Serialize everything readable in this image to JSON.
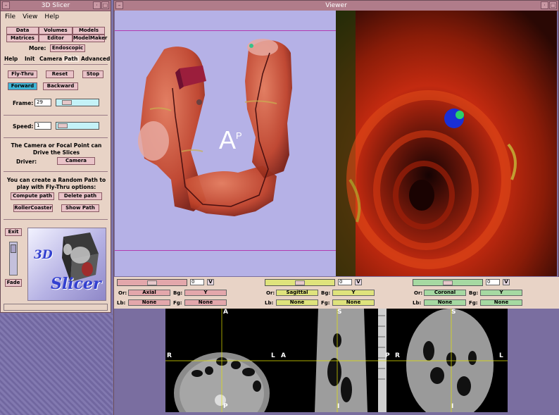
{
  "control_window": {
    "title": "3D Slicer",
    "menu": [
      "File",
      "View",
      "Help"
    ],
    "modules_row1": [
      "Data",
      "Volumes",
      "Models"
    ],
    "modules_row2": [
      "Matrices",
      "Editor",
      "ModelMaker"
    ],
    "more_label": "More:",
    "more_value": "Endoscopic",
    "tabs": [
      "Help",
      "Init",
      "Camera",
      "Path",
      "Advanced"
    ],
    "path": {
      "fly_thru": "Fly-Thru",
      "reset": "Reset",
      "stop": "Stop",
      "forward": "Forward",
      "backward": "Backward",
      "frame_label": "Frame:",
      "frame_value": "29",
      "speed_label": "Speed:",
      "speed_value": "1",
      "camera_note": "The Camera or Focal Point can Drive the Slices",
      "driver_label": "Driver:",
      "driver_value": "Camera",
      "random_note": "You can create a Random Path to play with Fly-Thru options:",
      "compute_path": "Compute path",
      "delete_path": "Delete path",
      "rollercoaster": "RollerCoaster",
      "show_path": "Show Path"
    },
    "exit": "Exit",
    "fade": "Fade",
    "logo_text_1": "3D",
    "logo_text_2": "Slicer"
  },
  "viewer_window": {
    "title": "Viewer",
    "orientation_letters": [
      "A",
      "P"
    ]
  },
  "slice_controls": [
    {
      "value": "0",
      "v": "V",
      "or_label": "Or:",
      "or_value": "Axial",
      "bg_label": "Bg:",
      "bg_value": "Y",
      "lb_label": "Lb:",
      "lb_value": "None",
      "fg_label": "Fg:",
      "fg_value": "None",
      "color": "#e3a7ab"
    },
    {
      "value": "0",
      "v": "V",
      "or_label": "Or:",
      "or_value": "Sagittal",
      "bg_label": "Bg:",
      "bg_value": "Y",
      "lb_label": "Lb:",
      "lb_value": "None",
      "fg_label": "Fg:",
      "fg_value": "None",
      "color": "#dfe37c"
    },
    {
      "value": "0",
      "v": "V",
      "or_label": "Or:",
      "or_value": "Coronal",
      "bg_label": "Bg:",
      "bg_value": "Y",
      "lb_label": "Lb:",
      "lb_value": "None",
      "fg_label": "Fg:",
      "fg_value": "None",
      "color": "#a6d9a2"
    }
  ],
  "slice_labels": {
    "axial": {
      "top": "A",
      "left": "R",
      "right": "L",
      "bottom": "P"
    },
    "sagittal": {
      "top": "S",
      "left": "A",
      "right": "P",
      "bottom": "I"
    },
    "coronal": {
      "top": "S",
      "left": "R",
      "right": "L",
      "bottom": "I"
    }
  },
  "colors": {
    "accent_blue": "#3fb6d6",
    "titlebar": "#b07c8a",
    "panel": "#e8d3c6",
    "viewport_bg": "#b5b1e6"
  }
}
